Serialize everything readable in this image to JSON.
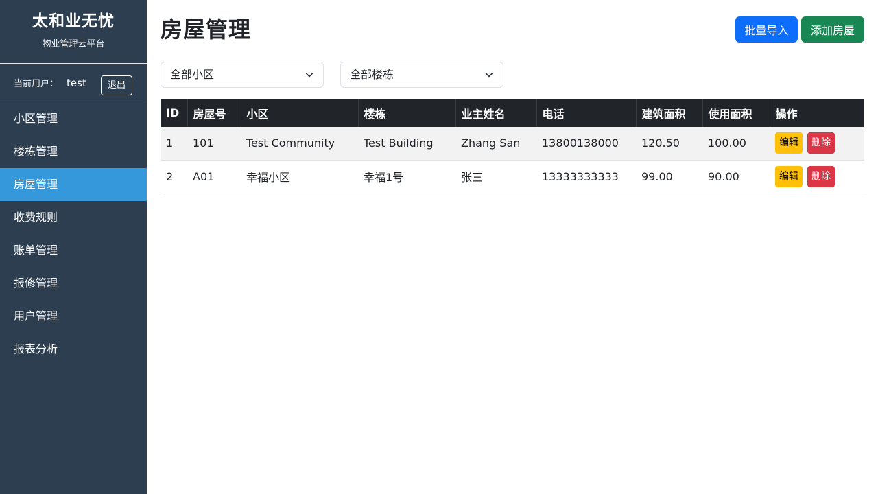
{
  "sidebar": {
    "brand_title": "太和业无忧",
    "brand_subtitle": "物业管理云平台",
    "user_label": "当前用户：",
    "user_name": "test",
    "logout_label": "退出",
    "items": [
      {
        "label": "小区管理",
        "active": false
      },
      {
        "label": "楼栋管理",
        "active": false
      },
      {
        "label": "房屋管理",
        "active": true
      },
      {
        "label": "收费规则",
        "active": false
      },
      {
        "label": "账单管理",
        "active": false
      },
      {
        "label": "报修管理",
        "active": false
      },
      {
        "label": "用户管理",
        "active": false
      },
      {
        "label": "报表分析",
        "active": false
      }
    ]
  },
  "main": {
    "title": "房屋管理",
    "import_label": "批量导入",
    "add_label": "添加房屋",
    "filters": {
      "community": "全部小区",
      "building": "全部楼栋"
    },
    "table": {
      "columns": [
        "ID",
        "房屋号",
        "小区",
        "楼栋",
        "业主姓名",
        "电话",
        "建筑面积",
        "使用面积",
        "操作"
      ],
      "rows": [
        {
          "id": "1",
          "room": "101",
          "community": "Test Community",
          "building": "Test Building",
          "owner": "Zhang San",
          "phone": "13800138000",
          "build_area": "120.50",
          "use_area": "100.00"
        },
        {
          "id": "2",
          "room": "A01",
          "community": "幸福小区",
          "building": "幸福1号",
          "owner": "张三",
          "phone": "13333333333",
          "build_area": "99.00",
          "use_area": "90.00"
        }
      ],
      "edit_label": "编辑",
      "delete_label": "删除"
    }
  },
  "colors": {
    "sidebar_bg": "#2c3e50",
    "active_nav": "#3498db",
    "primary": "#0d6efd",
    "success": "#198754",
    "warning": "#ffc107",
    "danger": "#dc3545",
    "table_header": "#212529"
  },
  "icons": {
    "select_arrow": "chevron-down-icon"
  }
}
